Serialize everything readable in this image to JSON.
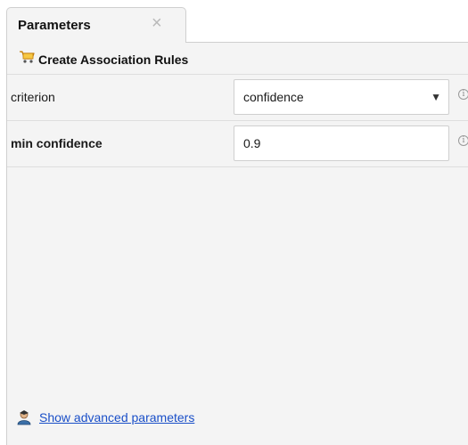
{
  "tab": {
    "title": "Parameters",
    "close_glyph": "×"
  },
  "operator": {
    "title": "Create Association Rules",
    "icon": "shopping-cart-icon"
  },
  "parameters": [
    {
      "label": "criterion",
      "type": "select",
      "value": "confidence",
      "bold": false
    },
    {
      "label": "min confidence",
      "type": "text",
      "value": "0.9",
      "bold": true
    }
  ],
  "info_glyph": "i",
  "advanced": {
    "label": "Show advanced parameters",
    "icon": "user-advanced-icon"
  },
  "colors": {
    "link": "#1a4fc8",
    "panel_bg": "#f4f4f4",
    "border": "#cfcfcf"
  }
}
